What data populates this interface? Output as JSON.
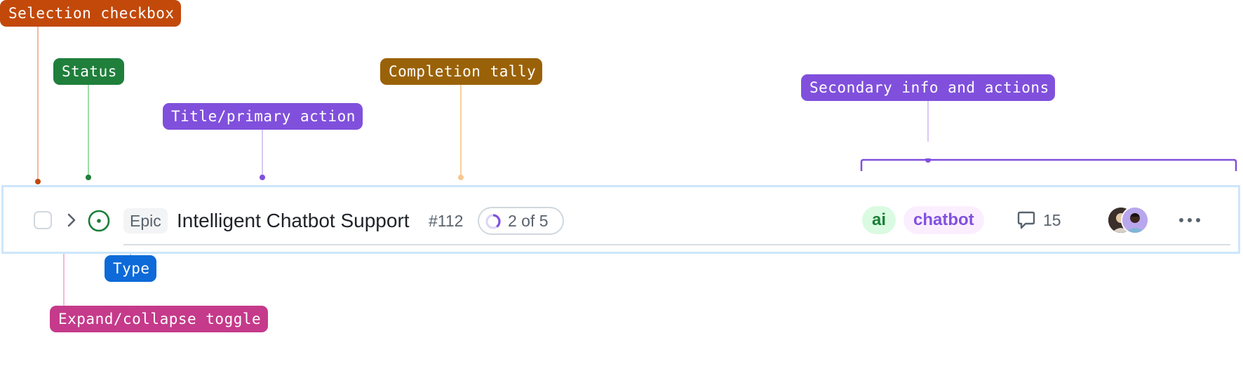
{
  "annotations": {
    "selection_checkbox": "Selection checkbox",
    "status": "Status",
    "title_primary_action": "Title/primary action",
    "completion_tally": "Completion tally",
    "secondary_info": "Secondary info and actions",
    "type": "Type",
    "expand_toggle": "Expand/collapse toggle"
  },
  "annotation_colors": {
    "selection_checkbox": "#c2490a",
    "status": "#1f7f3b",
    "title_primary_action": "#8050dc",
    "completion_tally": "#9a6208",
    "secondary_info": "#8050dc",
    "type": "#0d6ad8",
    "expand_toggle": "#c53a8a"
  },
  "row": {
    "type_label": "Epic",
    "title": "Intelligent Chatbot Support",
    "number": "#112",
    "tally": {
      "text": "2 of 5",
      "completed": 2,
      "total": 5
    },
    "labels": [
      {
        "name": "ai",
        "bg": "#dafbe1",
        "fg": "#1a7f37"
      },
      {
        "name": "chatbot",
        "bg": "#fbefff",
        "fg": "#8250df"
      }
    ],
    "comment_count": "15",
    "status_icon": "open-circle-icon",
    "toggle_icon": "chevron-right-icon",
    "comment_icon": "comment-icon",
    "more_icon": "kebab-horizontal-icon",
    "status_color": "#1a7f37",
    "row_border_color": "#cde6fb"
  }
}
